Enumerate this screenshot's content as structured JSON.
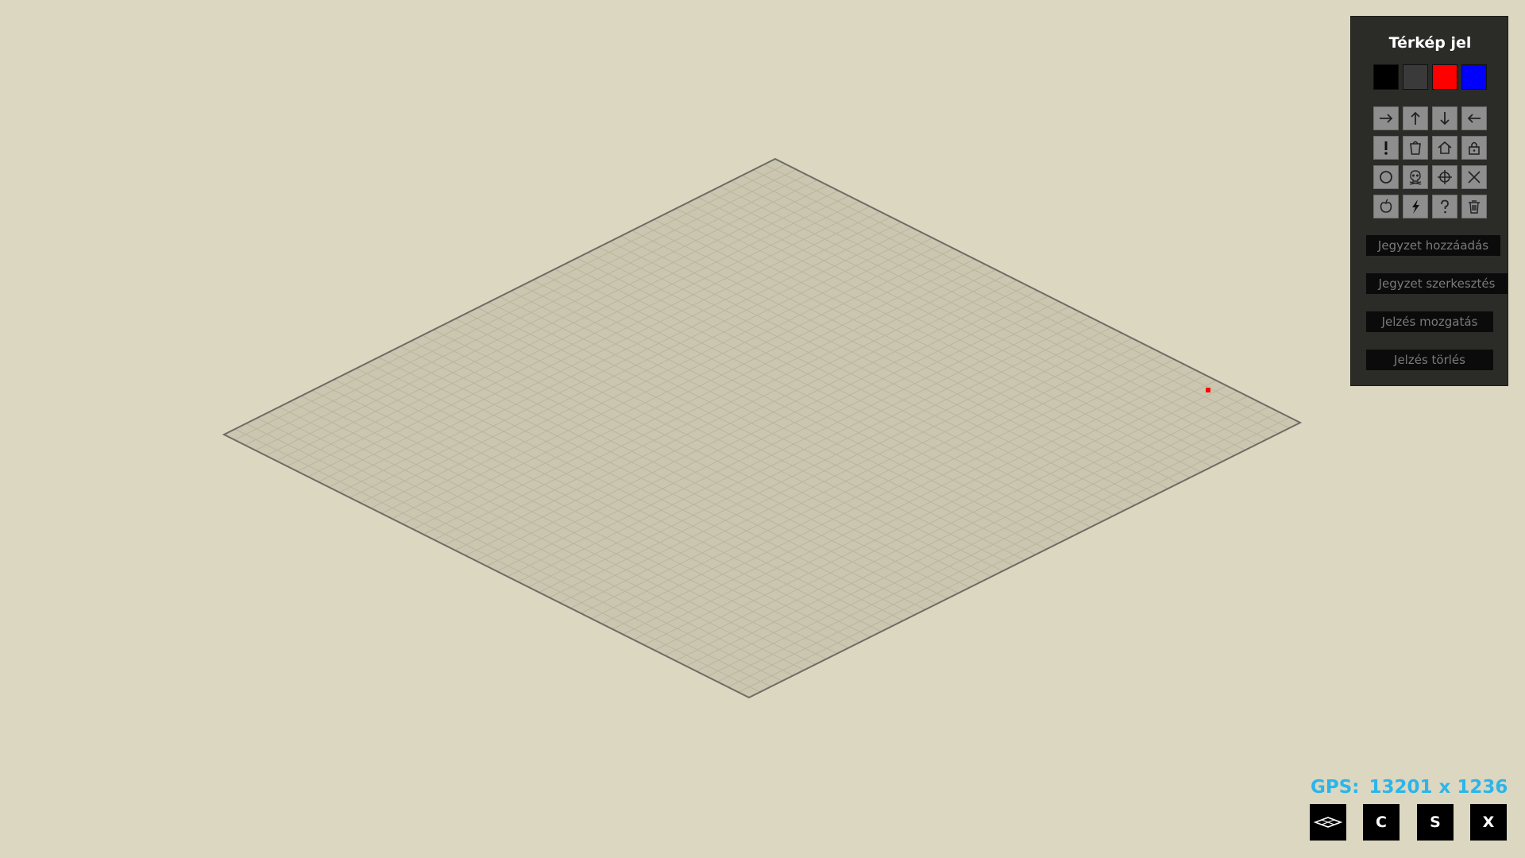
{
  "panel": {
    "title": "Térkép jel",
    "colors": [
      "#000000",
      "#3a3a3a",
      "#ff0000",
      "#0000ff"
    ],
    "icons": [
      [
        "arrow-right-icon",
        "arrow-up-icon",
        "arrow-down-icon",
        "arrow-left-icon"
      ],
      [
        "exclamation-icon",
        "bucket-icon",
        "house-icon",
        "lock-icon"
      ],
      [
        "circle-icon",
        "skull-icon",
        "crosshair-icon",
        "x-mark-icon"
      ],
      [
        "apple-icon",
        "lightning-icon",
        "question-icon",
        "trash-icon"
      ]
    ],
    "actions": {
      "add_note": "Jegyzet hozzáadás",
      "edit_note": "Jegyzet szerkesztés",
      "move_marker": "Jelzés mozgatás",
      "delete_marker": "Jelzés törlés"
    }
  },
  "map": {
    "marker_color": "#ff0000",
    "surface_color": "#cac6b0",
    "grid_color": "#b9b59f",
    "edge_color": "#6d6d66"
  },
  "gps": {
    "label": "GPS:",
    "value": "13201 x 1236"
  },
  "bottom_bar": {
    "layers_icon": "layers-icon",
    "c_label": "C",
    "s_label": "S",
    "x_label": "X"
  }
}
